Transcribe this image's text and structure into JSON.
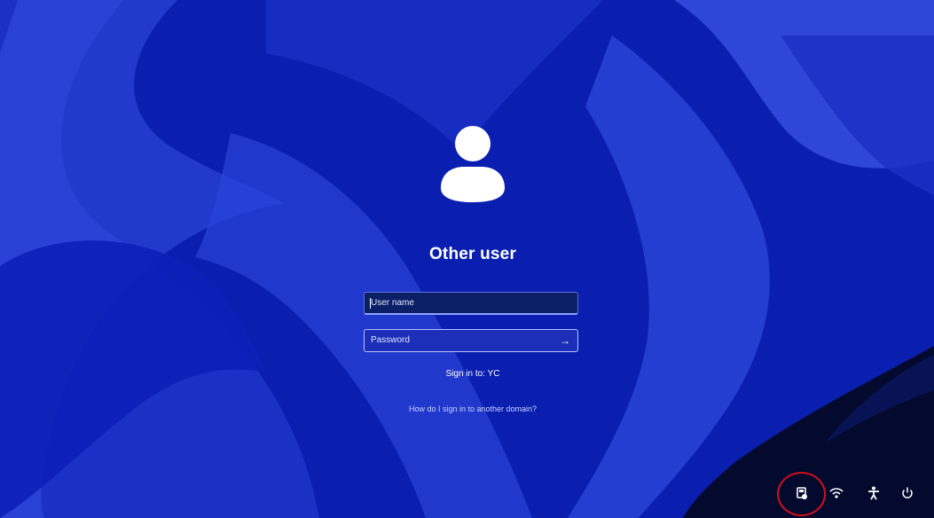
{
  "login": {
    "title": "Other user",
    "username_placeholder": "User name",
    "password_placeholder": "Password",
    "submit_icon": "arrow-right-icon",
    "sign_in_to": "Sign in to: YC",
    "domain_help": "How do I sign in to another domain?"
  },
  "tray": {
    "icons": [
      "network-settings-icon",
      "wifi-icon",
      "accessibility-icon",
      "power-icon"
    ],
    "highlighted": "network-settings-icon"
  },
  "colors": {
    "wallpaper_base": "#0a1fb0",
    "wallpaper_light": "#2f4be0",
    "corner_dark": "#040a2e",
    "highlight_ring": "#d1101a"
  }
}
